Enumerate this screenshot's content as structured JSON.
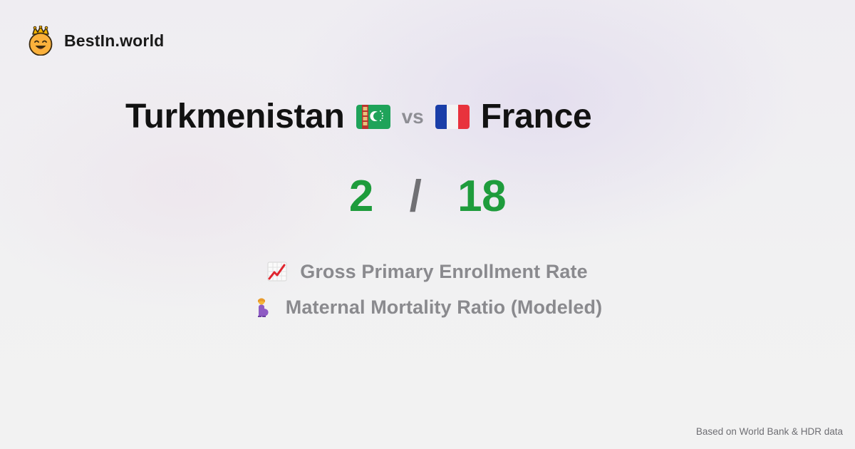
{
  "brand": {
    "name": "BestIn.world",
    "logo_icon": "crowned-smiley-icon"
  },
  "comparison": {
    "country_a": "Turkmenistan",
    "country_a_flag_icon": "turkmenistan-flag-icon",
    "vs": "vs",
    "country_b": "France",
    "country_b_flag_icon": "france-flag-icon"
  },
  "score": {
    "a": "2",
    "separator": "/",
    "b": "18",
    "color": "#1e9c3c"
  },
  "metrics": [
    {
      "icon": "chart-increasing-icon",
      "label": "Gross Primary Enrollment Rate"
    },
    {
      "icon": "pregnant-woman-icon",
      "label": "Maternal Mortality Ratio (Modeled)"
    }
  ],
  "footer": {
    "source": "Based on World Bank & HDR data"
  }
}
